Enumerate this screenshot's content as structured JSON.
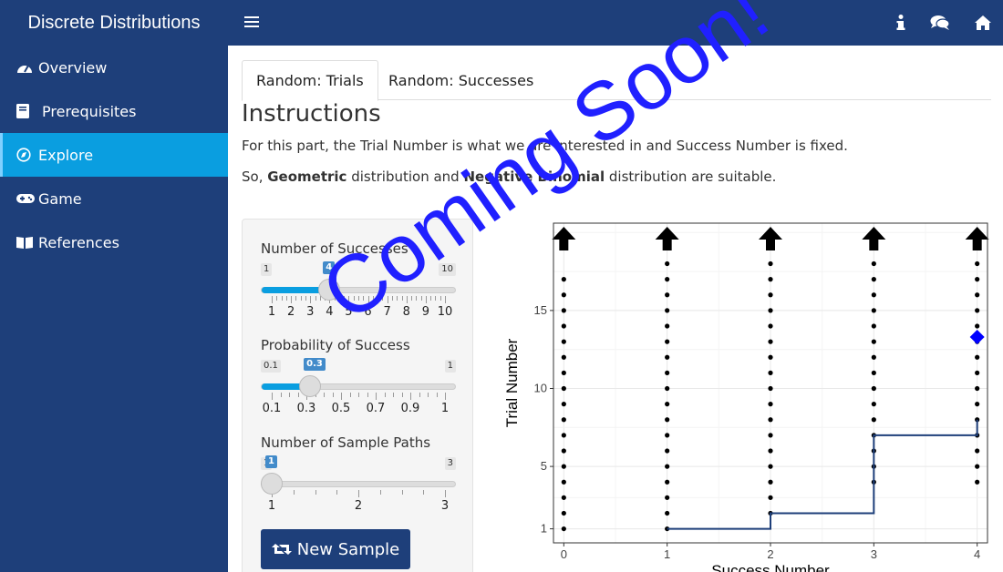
{
  "app": {
    "title": "Discrete Distributions"
  },
  "topbar": {
    "icons": [
      "info-icon",
      "comments-icon",
      "home-icon"
    ]
  },
  "sidebar": {
    "items": [
      {
        "label": "Overview",
        "icon": "tachometer-icon",
        "active": false
      },
      {
        "label": "Prerequisites",
        "icon": "book-icon",
        "active": false
      },
      {
        "label": "Explore",
        "icon": "wpexplorer-icon",
        "active": true
      },
      {
        "label": "Game",
        "icon": "gamepad-icon",
        "active": false
      },
      {
        "label": "References",
        "icon": "book-open-icon",
        "active": false
      }
    ]
  },
  "tabs": [
    {
      "label": "Random: Trials",
      "active": true
    },
    {
      "label": "Random: Successes",
      "active": false
    }
  ],
  "instructions": {
    "heading": "Instructions",
    "p1": "For this part, the Trial Number is what we are interested in and Success Number is fixed.",
    "p2_pre": "So, ",
    "p2_b1": "Geometric",
    "p2_mid": " distribution and ",
    "p2_b2": "Negative Binomial",
    "p2_post": " distribution are suitable."
  },
  "controls": {
    "successes": {
      "label": "Number of Successes",
      "min": "1",
      "max": "10",
      "value": "4",
      "fraction": 0.333,
      "ticks": [
        "1",
        "2",
        "3",
        "4",
        "5",
        "6",
        "7",
        "8",
        "9",
        "10"
      ]
    },
    "probability": {
      "label": "Probability of Success",
      "min": "0.1",
      "max": "1",
      "value": "0.3",
      "fraction": 0.222,
      "ticks": [
        "0.1",
        "0.3",
        "0.5",
        "0.7",
        "0.9",
        "1"
      ]
    },
    "paths": {
      "label": "Number of Sample Paths",
      "min": "1",
      "max": "3",
      "value": "1",
      "fraction": 0,
      "ticks": [
        "1",
        "2",
        "3"
      ]
    },
    "button_label": "New Sample"
  },
  "chart_data": {
    "type": "scatter",
    "xlabel": "Success Number",
    "ylabel": "Trial Number",
    "x_ticks": [
      "0",
      "1",
      "2",
      "3",
      "4"
    ],
    "y_ticks": [
      "1",
      "5",
      "10",
      "15"
    ],
    "xlim": [
      -0.1,
      4.1
    ],
    "ylim": [
      0.1,
      20.6
    ],
    "columns": [
      {
        "x": 0,
        "dots_from": 1,
        "dots_to": 17
      },
      {
        "x": 1,
        "dots_from": 1,
        "dots_to": 18
      },
      {
        "x": 2,
        "dots_from": 2,
        "dots_to": 18
      },
      {
        "x": 3,
        "dots_from": 4,
        "dots_to": 18
      },
      {
        "x": 4,
        "dots_from": 4,
        "dots_to": 18
      }
    ],
    "arrows_at_x": [
      0,
      1,
      2,
      3,
      4
    ],
    "path": [
      [
        1,
        1
      ],
      [
        2,
        1
      ],
      [
        2,
        2
      ],
      [
        3,
        2
      ],
      [
        3,
        7
      ],
      [
        4,
        7
      ],
      [
        4,
        8
      ]
    ],
    "path_color": "#1e3f7a",
    "diamond": {
      "x": 4,
      "y": 13.3,
      "color": "#0000ff"
    }
  },
  "watermark": "Coming Soon!"
}
